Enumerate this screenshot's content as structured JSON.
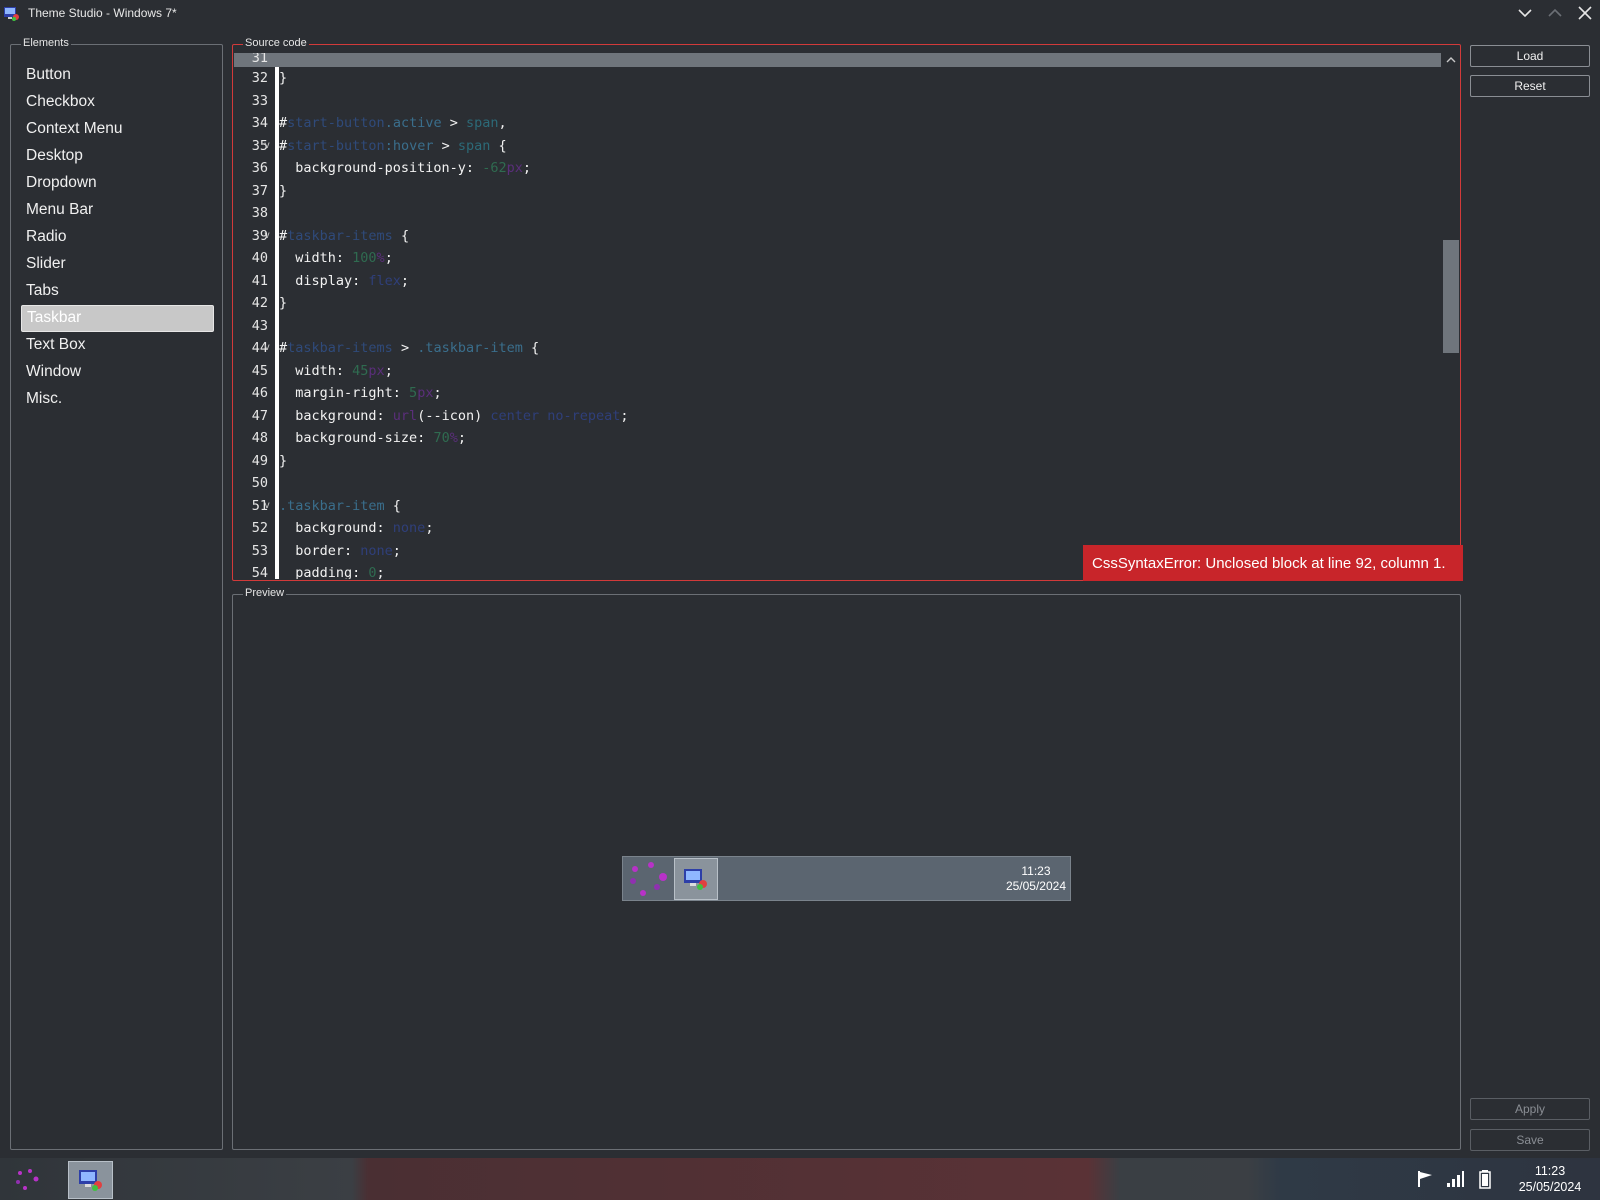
{
  "window": {
    "title": "Theme Studio - Windows 7*"
  },
  "elements_panel": {
    "label": "Elements",
    "items": [
      "Button",
      "Checkbox",
      "Context Menu",
      "Desktop",
      "Dropdown",
      "Menu Bar",
      "Radio",
      "Slider",
      "Tabs",
      "Taskbar",
      "Text Box",
      "Window",
      "Misc."
    ],
    "selected": "Taskbar"
  },
  "source_panel": {
    "label": "Source code",
    "lines": [
      {
        "n": "31",
        "segs": [
          {
            "t": "",
            "c": ""
          }
        ]
      },
      {
        "n": "32",
        "segs": [
          {
            "t": "}",
            "c": ""
          }
        ]
      },
      {
        "n": "33",
        "segs": [
          {
            "t": "",
            "c": ""
          }
        ]
      },
      {
        "n": "34",
        "segs": [
          {
            "t": "#",
            "c": ""
          },
          {
            "t": "start-button",
            "c": "tk-id"
          },
          {
            "t": ".active",
            "c": "tk-sel"
          },
          {
            "t": " > ",
            "c": ""
          },
          {
            "t": "span",
            "c": "tk-kw"
          },
          {
            "t": ",",
            "c": ""
          }
        ]
      },
      {
        "n": "35",
        "fold": true,
        "segs": [
          {
            "t": "#",
            "c": ""
          },
          {
            "t": "start-button",
            "c": "tk-id"
          },
          {
            "t": ":hover",
            "c": "tk-sel"
          },
          {
            "t": " > ",
            "c": ""
          },
          {
            "t": "span",
            "c": "tk-kw"
          },
          {
            "t": " {",
            "c": ""
          }
        ]
      },
      {
        "n": "36",
        "segs": [
          {
            "t": "  background-position-y: ",
            "c": ""
          },
          {
            "t": "-62",
            "c": "tk-num"
          },
          {
            "t": "px",
            "c": "tk-unit"
          },
          {
            "t": ";",
            "c": ""
          }
        ]
      },
      {
        "n": "37",
        "segs": [
          {
            "t": "}",
            "c": ""
          }
        ]
      },
      {
        "n": "38",
        "segs": [
          {
            "t": "",
            "c": ""
          }
        ]
      },
      {
        "n": "39",
        "fold": true,
        "segs": [
          {
            "t": "#",
            "c": ""
          },
          {
            "t": "taskbar-items",
            "c": "tk-id"
          },
          {
            "t": " {",
            "c": ""
          }
        ]
      },
      {
        "n": "40",
        "segs": [
          {
            "t": "  width: ",
            "c": ""
          },
          {
            "t": "100",
            "c": "tk-num"
          },
          {
            "t": "%",
            "c": "tk-unit"
          },
          {
            "t": ";",
            "c": ""
          }
        ]
      },
      {
        "n": "41",
        "segs": [
          {
            "t": "  display: ",
            "c": ""
          },
          {
            "t": "flex",
            "c": "tk-val"
          },
          {
            "t": ";",
            "c": ""
          }
        ]
      },
      {
        "n": "42",
        "segs": [
          {
            "t": "}",
            "c": ""
          }
        ]
      },
      {
        "n": "43",
        "segs": [
          {
            "t": "",
            "c": ""
          }
        ]
      },
      {
        "n": "44",
        "fold": true,
        "segs": [
          {
            "t": "#",
            "c": ""
          },
          {
            "t": "taskbar-items",
            "c": "tk-id"
          },
          {
            "t": " > ",
            "c": ""
          },
          {
            "t": ".taskbar-item",
            "c": "tk-sel"
          },
          {
            "t": " {",
            "c": ""
          }
        ]
      },
      {
        "n": "45",
        "segs": [
          {
            "t": "  width: ",
            "c": ""
          },
          {
            "t": "45",
            "c": "tk-num"
          },
          {
            "t": "px",
            "c": "tk-unit"
          },
          {
            "t": ";",
            "c": ""
          }
        ]
      },
      {
        "n": "46",
        "segs": [
          {
            "t": "  margin-right: ",
            "c": ""
          },
          {
            "t": "5",
            "c": "tk-num"
          },
          {
            "t": "px",
            "c": "tk-unit"
          },
          {
            "t": ";",
            "c": ""
          }
        ]
      },
      {
        "n": "47",
        "segs": [
          {
            "t": "  background: ",
            "c": ""
          },
          {
            "t": "url",
            "c": "tk-unit"
          },
          {
            "t": "(--icon) ",
            "c": ""
          },
          {
            "t": "center no-repeat",
            "c": "tk-val"
          },
          {
            "t": ";",
            "c": ""
          }
        ]
      },
      {
        "n": "48",
        "segs": [
          {
            "t": "  background-size: ",
            "c": ""
          },
          {
            "t": "70",
            "c": "tk-num"
          },
          {
            "t": "%",
            "c": "tk-unit"
          },
          {
            "t": ";",
            "c": ""
          }
        ]
      },
      {
        "n": "49",
        "segs": [
          {
            "t": "}",
            "c": ""
          }
        ]
      },
      {
        "n": "50",
        "segs": [
          {
            "t": "",
            "c": ""
          }
        ]
      },
      {
        "n": "51",
        "fold": true,
        "segs": [
          {
            "t": ".taskbar-item",
            "c": "tk-sel"
          },
          {
            "t": " {",
            "c": ""
          }
        ]
      },
      {
        "n": "52",
        "segs": [
          {
            "t": "  background: ",
            "c": ""
          },
          {
            "t": "none",
            "c": "tk-val"
          },
          {
            "t": ";",
            "c": ""
          }
        ]
      },
      {
        "n": "53",
        "segs": [
          {
            "t": "  border: ",
            "c": ""
          },
          {
            "t": "none",
            "c": "tk-val"
          },
          {
            "t": ";",
            "c": ""
          }
        ]
      },
      {
        "n": "54",
        "segs": [
          {
            "t": "  padding: ",
            "c": ""
          },
          {
            "t": "0",
            "c": "tk-num"
          },
          {
            "t": ";",
            "c": ""
          }
        ]
      }
    ],
    "error": "CssSyntaxError: Unclosed block at line 92, column 1."
  },
  "preview_panel": {
    "label": "Preview",
    "clock_time": "11:23",
    "clock_date": "25/05/2024"
  },
  "buttons": {
    "load": "Load",
    "reset": "Reset",
    "apply": "Apply",
    "save": "Save"
  },
  "os_taskbar": {
    "clock_time": "11:23",
    "clock_date": "25/05/2024"
  },
  "icons": {
    "app": "theme-studio-icon",
    "minimize": "chevron-down-icon",
    "maximize": "chevron-up-icon",
    "close": "close-icon",
    "flag": "flag-icon",
    "signal": "signal-icon",
    "battery": "battery-icon"
  },
  "colors": {
    "error": "#c8252a",
    "accent_border": "#d23a3a",
    "selected_item": "#c8c8c8"
  }
}
